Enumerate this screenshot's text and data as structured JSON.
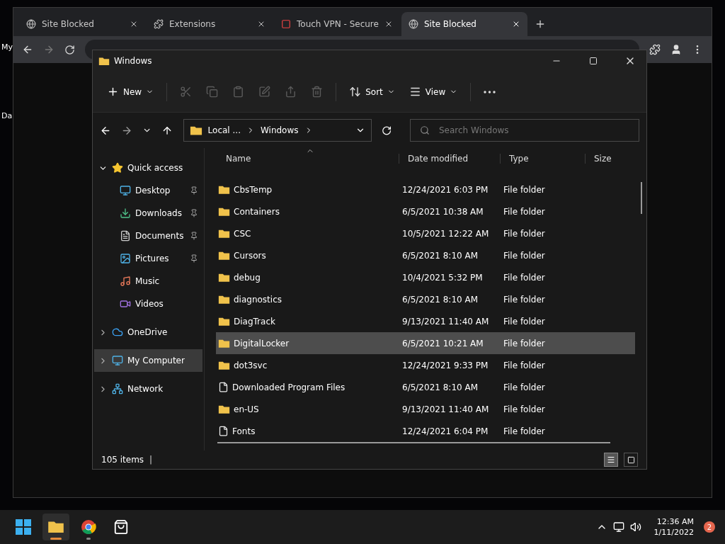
{
  "desktop_icons": [
    {
      "label": "My"
    },
    {
      "label": "Da"
    }
  ],
  "browser": {
    "tabs": [
      {
        "label": "Site Blocked",
        "selected": false
      },
      {
        "label": "Extensions",
        "selected": false
      },
      {
        "label": "Touch VPN - Secure",
        "selected": false
      },
      {
        "label": "Site Blocked",
        "selected": true
      }
    ]
  },
  "explorer": {
    "title": "Windows",
    "toolbar": [
      {
        "kind": "new",
        "label": "New",
        "disabled": false
      },
      {
        "kind": "cut",
        "disabled": true
      },
      {
        "kind": "copy",
        "disabled": true
      },
      {
        "kind": "paste",
        "disabled": true
      },
      {
        "kind": "rename",
        "disabled": true
      },
      {
        "kind": "share",
        "disabled": true
      },
      {
        "kind": "delete",
        "disabled": true
      },
      {
        "kind": "sort",
        "label": "Sort",
        "disabled": false
      },
      {
        "kind": "view",
        "label": "View",
        "disabled": false
      },
      {
        "kind": "more",
        "disabled": false
      }
    ],
    "breadcrumb": [
      "Local ...",
      "Windows"
    ],
    "search": {
      "placeholder": "Search Windows"
    },
    "sidebar": [
      {
        "label": "Quick access",
        "expanded": true,
        "selected": false,
        "children": [
          {
            "label": "Desktop",
            "pinned": true
          },
          {
            "label": "Downloads",
            "pinned": true
          },
          {
            "label": "Documents",
            "pinned": true
          },
          {
            "label": "Pictures",
            "pinned": true
          },
          {
            "label": "Music",
            "pinned": false
          },
          {
            "label": "Videos",
            "pinned": false
          }
        ]
      },
      {
        "label": "OneDrive",
        "expanded": false,
        "selected": false
      },
      {
        "label": "My Computer",
        "expanded": false,
        "selected": true
      },
      {
        "label": "Network",
        "expanded": false,
        "selected": false
      }
    ],
    "columns": [
      "Name",
      "Date modified",
      "Type",
      "Size"
    ],
    "rows": [
      {
        "name": "CbsTemp",
        "date": "12/24/2021 6:03 PM",
        "type": "File folder",
        "kind": "folder",
        "selected": false
      },
      {
        "name": "Containers",
        "date": "6/5/2021 10:38 AM",
        "type": "File folder",
        "kind": "folder",
        "selected": false
      },
      {
        "name": "CSC",
        "date": "10/5/2021 12:22 AM",
        "type": "File folder",
        "kind": "folder",
        "selected": false
      },
      {
        "name": "Cursors",
        "date": "6/5/2021 8:10 AM",
        "type": "File folder",
        "kind": "folder",
        "selected": false
      },
      {
        "name": "debug",
        "date": "10/4/2021 5:32 PM",
        "type": "File folder",
        "kind": "folder",
        "selected": false
      },
      {
        "name": "diagnostics",
        "date": "6/5/2021 8:10 AM",
        "type": "File folder",
        "kind": "folder",
        "selected": false
      },
      {
        "name": "DiagTrack",
        "date": "9/13/2021 11:40 AM",
        "type": "File folder",
        "kind": "folder",
        "selected": false
      },
      {
        "name": "DigitalLocker",
        "date": "6/5/2021 10:21 AM",
        "type": "File folder",
        "kind": "folder",
        "selected": true
      },
      {
        "name": "dot3svc",
        "date": "12/24/2021 9:33 PM",
        "type": "File folder",
        "kind": "folder",
        "selected": false
      },
      {
        "name": "Downloaded Program Files",
        "date": "6/5/2021 8:10 AM",
        "type": "File folder",
        "kind": "file",
        "selected": false
      },
      {
        "name": "en-US",
        "date": "9/13/2021 11:40 AM",
        "type": "File folder",
        "kind": "folder",
        "selected": false
      },
      {
        "name": "Fonts",
        "date": "12/24/2021 6:04 PM",
        "type": "File folder",
        "kind": "file",
        "selected": false
      }
    ],
    "status": "105 items",
    "status_separator": "|",
    "view_buttons": [
      {
        "selected": true
      },
      {
        "selected": false
      }
    ]
  },
  "taskbar": {
    "apps": [
      {
        "kind": "start",
        "selected": false
      },
      {
        "kind": "explorer",
        "selected": true
      },
      {
        "kind": "chrome",
        "selected": false
      },
      {
        "kind": "store",
        "selected": false
      }
    ],
    "time": "12:36 AM",
    "date": "1/11/2022",
    "badge": "2"
  }
}
